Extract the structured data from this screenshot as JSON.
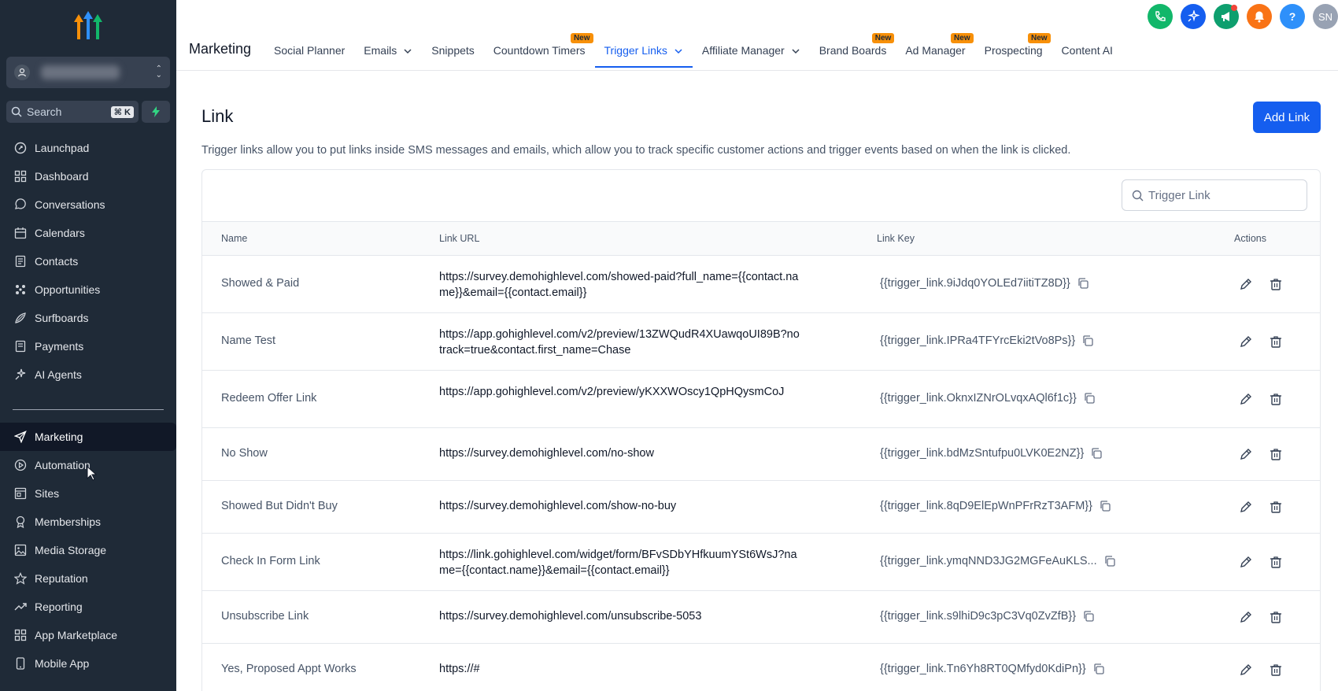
{
  "sidebar": {
    "search_placeholder": "Search",
    "search_shortcut": "⌘ K",
    "items": [
      {
        "label": "Launchpad",
        "icon": "launchpad-icon"
      },
      {
        "label": "Dashboard",
        "icon": "dashboard-icon"
      },
      {
        "label": "Conversations",
        "icon": "chat-icon"
      },
      {
        "label": "Calendars",
        "icon": "calendar-icon"
      },
      {
        "label": "Contacts",
        "icon": "contacts-icon"
      },
      {
        "label": "Opportunities",
        "icon": "opportunities-icon"
      },
      {
        "label": "Surfboards",
        "icon": "surfboard-icon"
      },
      {
        "label": "Payments",
        "icon": "payments-icon"
      },
      {
        "label": "AI Agents",
        "icon": "ai-sparkle-icon"
      }
    ],
    "items2": [
      {
        "label": "Marketing",
        "icon": "send-icon",
        "active": true
      },
      {
        "label": "Automation",
        "icon": "automation-icon"
      },
      {
        "label": "Sites",
        "icon": "sites-icon"
      },
      {
        "label": "Memberships",
        "icon": "membership-icon"
      },
      {
        "label": "Media Storage",
        "icon": "media-icon"
      },
      {
        "label": "Reputation",
        "icon": "star-icon"
      },
      {
        "label": "Reporting",
        "icon": "trend-icon"
      },
      {
        "label": "App Marketplace",
        "icon": "grid-icon"
      },
      {
        "label": "Mobile App",
        "icon": "mobile-icon"
      }
    ]
  },
  "topbar": {
    "title": "Marketing",
    "tabs": [
      {
        "label": "Social Planner"
      },
      {
        "label": "Emails",
        "dropdown": true
      },
      {
        "label": "Snippets"
      },
      {
        "label": "Countdown Timers",
        "badge": "New"
      },
      {
        "label": "Trigger Links",
        "dropdown": true,
        "active": true
      },
      {
        "label": "Affiliate Manager",
        "dropdown": true
      },
      {
        "label": "Brand Boards",
        "badge": "New"
      },
      {
        "label": "Ad Manager",
        "badge": "New"
      },
      {
        "label": "Prospecting",
        "badge": "New"
      },
      {
        "label": "Content AI"
      }
    ],
    "user_initials": "SN",
    "help_label": "?"
  },
  "main": {
    "title": "Link",
    "add_button": "Add Link",
    "description": "Trigger links allow you to put links inside SMS messages and emails, which allow you to track specific customer actions and trigger events based on when the link is clicked.",
    "search_placeholder": "Trigger Link",
    "columns": {
      "name": "Name",
      "url": "Link URL",
      "key": "Link Key",
      "actions": "Actions"
    },
    "rows": [
      {
        "name": "Showed & Paid",
        "url": "https://survey.demohighlevel.com/showed-paid?full_name={{contact.name}}&email={{contact.email}}",
        "key": "{{trigger_link.9iJdq0YOLEd7iitiTZ8D}}"
      },
      {
        "name": "Name Test",
        "url": "https://app.gohighlevel.com/v2/preview/13ZWQudR4XUawqoUI89B?notrack=true&contact.first_name=Chase",
        "key": "{{trigger_link.IPRa4TFYrcEki2tVo8Ps}}"
      },
      {
        "name": "Redeem Offer Link",
        "url": "https://app.gohighlevel.com/v2/preview/yKXXWOscy1QpHQysmCoJ",
        "key": "{{trigger_link.OknxIZNrOLvqxAQl6f1c}}"
      },
      {
        "name": "No Show",
        "url": "https://survey.demohighlevel.com/no-show",
        "key": "{{trigger_link.bdMzSntufpu0LVK0E2NZ}}"
      },
      {
        "name": "Showed But Didn't Buy",
        "url": "https://survey.demohighlevel.com/show-no-buy",
        "key": "{{trigger_link.8qD9ElEpWnPFrRzT3AFM}}"
      },
      {
        "name": "Check In Form Link",
        "url": "https://link.gohighlevel.com/widget/form/BFvSDbYHfkuumYSt6WsJ?name={{contact.name}}&email={{contact.email}}",
        "key": "{{trigger_link.ymqNND3JG2MGFeAuKLS..."
      },
      {
        "name": "Unsubscribe Link",
        "url": "https://survey.demohighlevel.com/unsubscribe-5053",
        "key": "{{trigger_link.s9lhiD9c3pC3Vq0ZvZfB}}"
      },
      {
        "name": "Yes, Proposed Appt Works",
        "url": "https://#",
        "key": "{{trigger_link.Tn6Yh8RT0QMfyd0KdiPn}}"
      }
    ]
  },
  "colors": {
    "sidebar_bg": "#1f2a37",
    "accent": "#155eef",
    "new_badge": "#f79009",
    "phone": "#12b76a",
    "sparkle": "#155eef",
    "megaphone": "#0e9f6e",
    "bell": "#f97316",
    "help": "#2e90fa",
    "avatar": "#98a2b3"
  }
}
